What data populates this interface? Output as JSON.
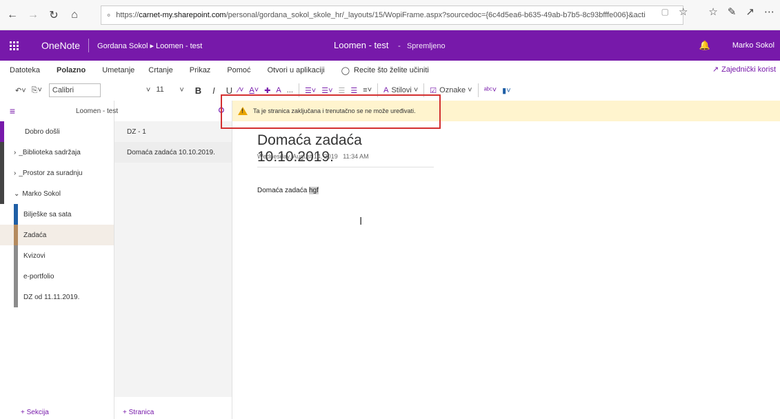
{
  "browser": {
    "url_prefix": "https://",
    "url_host": "carnet-my.sharepoint.com",
    "url_rest": "/personal/gordana_sokol_skole_hr/_layouts/15/WopiFrame.aspx?sourcedoc={6c4d5ea6-b635-49ab-b7b5-8c93bfffe006}&acti"
  },
  "header": {
    "app_name": "OneNote",
    "breadcrumb": "Gordana Sokol ▸ Loomen - test",
    "doc_title": "Loomen - test",
    "saved_sep": "-",
    "saved_status": "Spremljeno",
    "user_name": "Marko Sokol"
  },
  "ribbon": {
    "tabs": [
      "Datoteka",
      "Polazno",
      "Umetanje",
      "Crtanje",
      "Prikaz",
      "Pomoć",
      "Otvori u aplikaciji"
    ],
    "tell_me": "Recite što želite učiniti",
    "share": "Zajednički korist"
  },
  "toolbar": {
    "font": "Calibri",
    "size": "11",
    "bold": "B",
    "italic": "I",
    "underline": "U",
    "more": "...",
    "styles": "Stilovi",
    "tags": "Oznake"
  },
  "nav": {
    "notebook": "Loomen - test",
    "sections": [
      {
        "label": "Dobro došli",
        "color": "#7719aa",
        "indent": 0,
        "caret": ""
      },
      {
        "label": "_Biblioteka sadržaja",
        "color": "#444444",
        "indent": 0,
        "caret": ">"
      },
      {
        "label": "_Prostor za suradnju",
        "color": "#444444",
        "indent": 0,
        "caret": ">"
      },
      {
        "label": "Marko Sokol",
        "color": "#444444",
        "indent": 0,
        "caret": "v"
      },
      {
        "label": "Bilješke sa sata",
        "color": "#1f5fa6",
        "indent": 1,
        "caret": ""
      },
      {
        "label": "Zadaća",
        "color": "#b48a5e",
        "indent": 1,
        "caret": ""
      },
      {
        "label": "Kvizovi",
        "color": "#8c8c8c",
        "indent": 1,
        "caret": ""
      },
      {
        "label": "e-portfolio",
        "color": "#8c8c8c",
        "indent": 1,
        "caret": ""
      },
      {
        "label": "DZ od 11.11.2019.",
        "color": "#8c8c8c",
        "indent": 1,
        "caret": ""
      }
    ],
    "add_section": "+ Sekcija",
    "add_page": "+ Stranica"
  },
  "pages": [
    "DZ - 1",
    "Domaća zadaća 10.10.2019."
  ],
  "warning": "Ta je stranica zaključana i trenutačno se ne može uređivati.",
  "page": {
    "title": "Domaća zadaća 10.10.2019.",
    "date": "Wednesday, August 14, 2019",
    "time": "11:34 AM",
    "text": "Domaća zadaća",
    "highlight": "hgf"
  }
}
